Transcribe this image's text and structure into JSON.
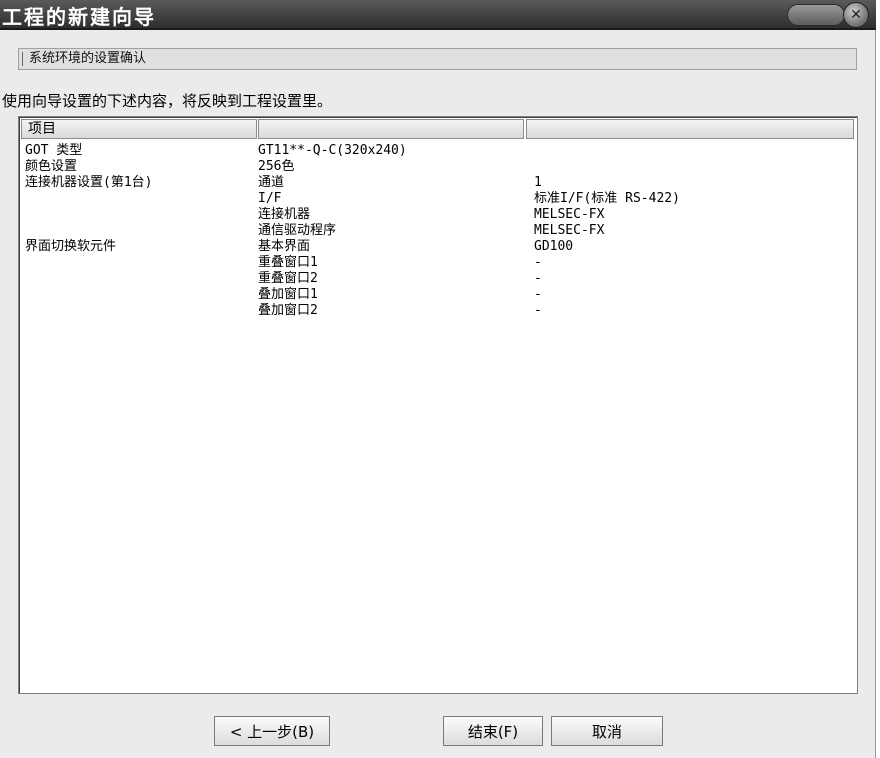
{
  "window": {
    "title": "工程的新建向导"
  },
  "section": {
    "header": "系统环境的设置确认",
    "instruction": "使用向导设置的下述内容，将反映到工程设置里。"
  },
  "table": {
    "columns": [
      "项目",
      "",
      ""
    ],
    "rows": [
      [
        "GOT 类型",
        "GT11**-Q-C(320x240)",
        ""
      ],
      [
        "颜色设置",
        "256色",
        ""
      ],
      [
        "连接机器设置(第1台)",
        "通道",
        "1"
      ],
      [
        "",
        "I/F",
        "标准I/F(标准 RS-422)"
      ],
      [
        "",
        "连接机器",
        "MELSEC-FX"
      ],
      [
        "",
        "通信驱动程序",
        "MELSEC-FX"
      ],
      [
        "界面切换软元件",
        "基本界面",
        "GD100"
      ],
      [
        "",
        "重叠窗口1",
        "-"
      ],
      [
        "",
        "重叠窗口2",
        "-"
      ],
      [
        "",
        "叠加窗口1",
        "-"
      ],
      [
        "",
        "叠加窗口2",
        "-"
      ]
    ]
  },
  "buttons": {
    "prev": "< 上一步(B)",
    "finish": "结束(F)",
    "cancel": "取消"
  },
  "icons": {
    "close": "close-icon"
  }
}
